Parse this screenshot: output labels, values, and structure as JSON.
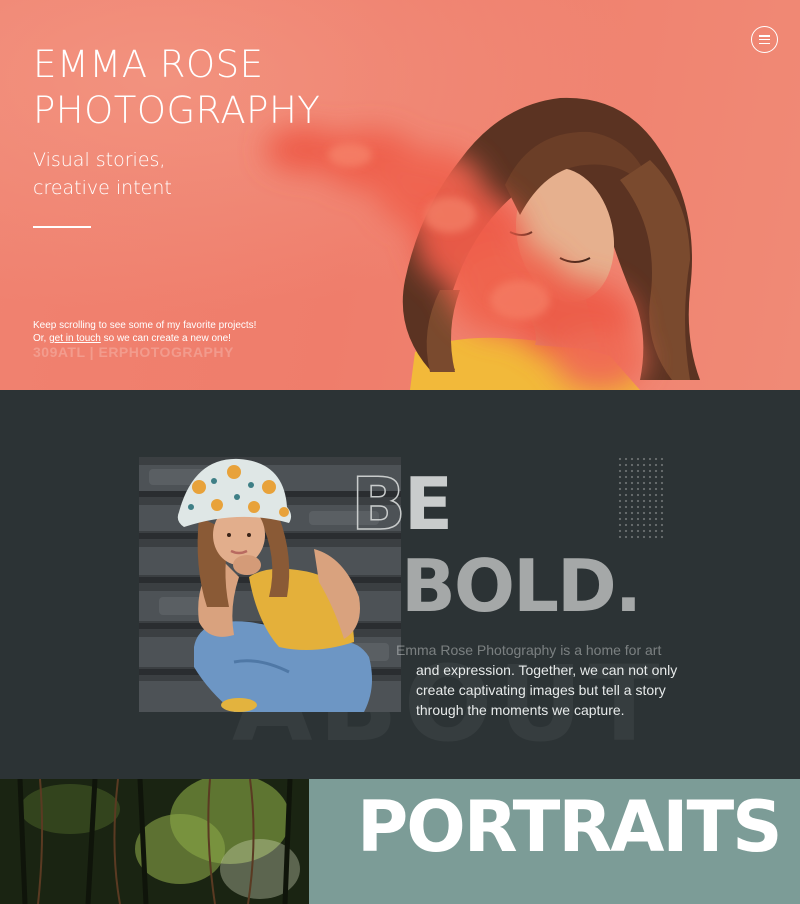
{
  "hero": {
    "title_line1": "EMMA ROSE",
    "title_line2": "PHOTOGRAPHY",
    "subtitle_line1": "Visual stories,",
    "subtitle_line2": "creative intent",
    "note_line1": "Keep scrolling to see some of my favorite projects!",
    "note_line2_prefix": "Or, ",
    "note_link": "get in touch",
    "note_line2_suffix": " so we can create a new one!",
    "handle": "309ATL | ERPHOTOGRAPHY",
    "menu_icon": "hamburger-menu-icon",
    "background_color": "#ef7d6b",
    "smoke_color": "#ef5d4a",
    "top_color": "#f2b93a"
  },
  "about": {
    "headline_outline": "B",
    "headline_solid": "E",
    "headline_line2": "BOLD.",
    "paragraph_line1": "Emma Rose Photography is a home for art",
    "paragraph_line2": "and expression. Together, we can not only",
    "paragraph_line3": "create captivating images but tell a story",
    "paragraph_line4": "through the moments we capture.",
    "ghost_word": "ABOUT",
    "background_color": "#2c3335"
  },
  "portraits": {
    "title": "PORTRAITS",
    "panel_color": "#7c9c97"
  }
}
